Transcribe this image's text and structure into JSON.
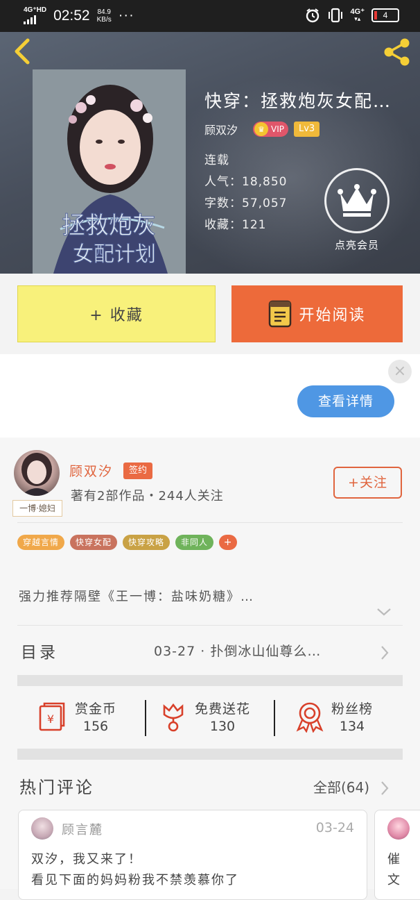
{
  "status_bar": {
    "network": "4G⁺HD",
    "time": "02:52",
    "speed_value": "84.9",
    "speed_unit": "KB/s",
    "more": "···",
    "data_network": "4G⁺",
    "battery": "4"
  },
  "book": {
    "title": "快穿：拯救炮灰女配…",
    "author": "顾双汐",
    "vip_label": "VIP",
    "level": "Lv3",
    "status": "连载",
    "popularity": "人气：18,850",
    "word_count": "字数：57,057",
    "favorites": "收藏：121",
    "member_label": "点亮会员"
  },
  "actions": {
    "favorite_label": "+ 收藏",
    "read_label": "开始阅读"
  },
  "ad": {
    "close": "×",
    "detail_label": "查看详情"
  },
  "author_section": {
    "name": "顾双汐",
    "signed_badge": "签约",
    "meta": "著有2部作品・244人关注",
    "follow_label": "+关注",
    "avatar_tag": "一博·媳妇",
    "tags": [
      {
        "label": "穿越言情",
        "color": "#f0a84a"
      },
      {
        "label": "快穿女配",
        "color": "#c9735e"
      },
      {
        "label": "快穿攻略",
        "color": "#c9a245"
      },
      {
        "label": "非同人",
        "color": "#6fb35b"
      },
      {
        "label": "+",
        "color": "#ea6a43"
      }
    ],
    "recommendation": "强力推荐隔壁《王一博：盐味奶糖》…"
  },
  "toc": {
    "label": "目录",
    "latest": "03-27 · 扑倒冰山仙尊么…"
  },
  "gifts": [
    {
      "label": "赏金币",
      "count": "156"
    },
    {
      "label": "免费送花",
      "count": "130"
    },
    {
      "label": "粉丝榜",
      "count": "134"
    }
  ],
  "comments": {
    "title": "热门评论",
    "all_label": "全部(64)",
    "items": [
      {
        "user": "顾言麓",
        "date": "03-24",
        "line1": "双汐，我又来了！",
        "line2": "看见下面的妈妈粉我不禁羡慕你了"
      },
      {
        "line1": "催",
        "line2": "文"
      }
    ]
  },
  "colors": {
    "accent_orange": "#ed6a3a",
    "favorite_yellow": "#f8f17b",
    "ad_blue": "#4f97e4"
  }
}
